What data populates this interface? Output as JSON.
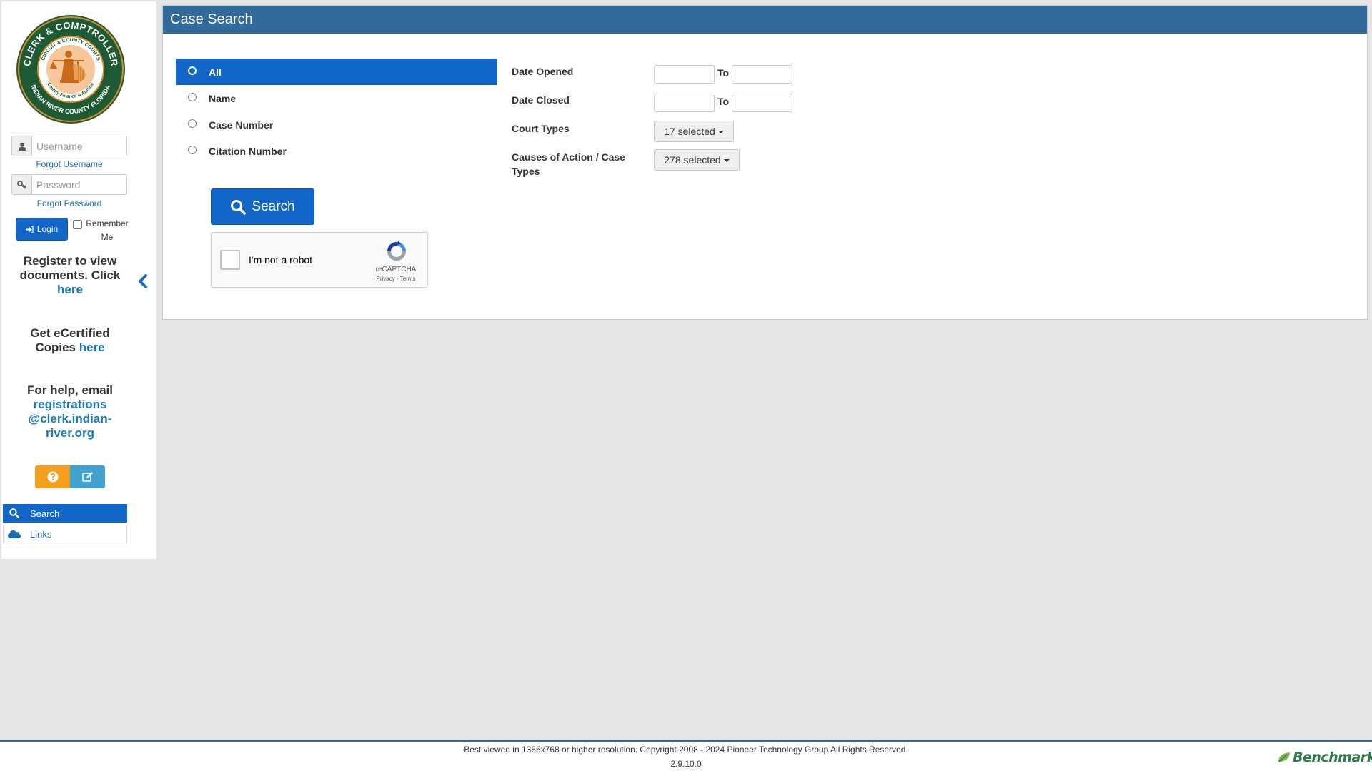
{
  "sidebar": {
    "seal_text_top": "CLERK & COMPTROLLER",
    "seal_text_inner": "CIRCUIT & COUNTY COURTS",
    "seal_text_mid": "County Finance & Auditor",
    "seal_text_bottom": "INDIAN RIVER COUNTY FLORIDA",
    "username_placeholder": "Username",
    "forgot_username": "Forgot Username",
    "password_placeholder": "Password",
    "forgot_password": "Forgot Password",
    "login_label": "Login",
    "remember_label": "Remember Me",
    "register_text": "Register to view documents. Click",
    "register_link": "here",
    "ecert_text": "Get eCertified Copies",
    "ecert_link": "here",
    "help_text": "For help, email",
    "help_email_1": "registrations",
    "help_email_2": "@clerk.indian-",
    "help_email_3": "river.org",
    "nav": [
      {
        "label": "Search",
        "icon": "search-icon",
        "active": true
      },
      {
        "label": "Links",
        "icon": "cloud-icon",
        "active": false
      }
    ],
    "colors": {
      "help_button": "#f4a01c",
      "edit_button": "#42a2cf"
    }
  },
  "main": {
    "title": "Case Search",
    "search_types": [
      {
        "label": "All",
        "selected": true
      },
      {
        "label": "Name",
        "selected": false
      },
      {
        "label": "Case Number",
        "selected": false
      },
      {
        "label": "Citation Number",
        "selected": false
      }
    ],
    "search_button": "Search",
    "captcha": {
      "label": "I'm not a robot",
      "brand": "reCAPTCHA",
      "terms": "Privacy - Terms"
    },
    "filters": {
      "date_opened": "Date Opened",
      "date_closed": "Date Closed",
      "to_label": "To",
      "court_types": "Court Types",
      "court_types_value": "17 selected",
      "causes_label_1": "Causes of Action / Case",
      "causes_label_2": "Types",
      "causes_value": "278 selected"
    }
  },
  "footer": {
    "copyright": "Best viewed in 1366x768 or higher resolution. Copyright 2008 - 2024 Pioneer Technology Group All Rights Reserved.",
    "version": "2.9.10.0",
    "logo_text": "Benchmark"
  },
  "colors": {
    "header": "#336a9c",
    "primary": "#1166c7",
    "link": "#1a7ab8",
    "background": "#e5e5e5"
  }
}
